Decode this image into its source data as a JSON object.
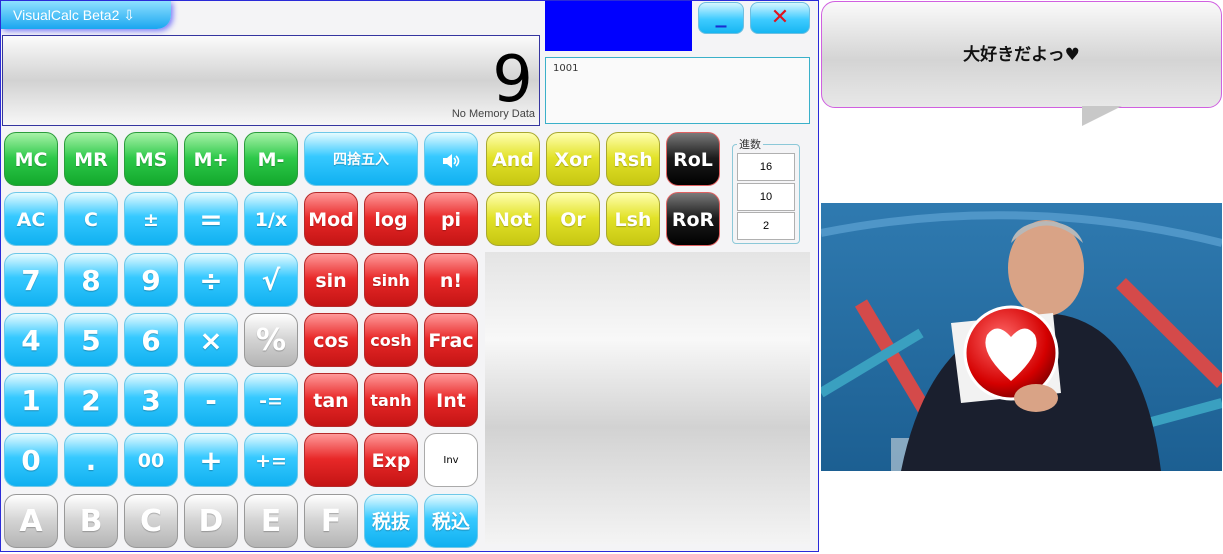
{
  "window": {
    "title": "VisualCalc Beta2",
    "title_icon": "⇩",
    "minimize_label": "_",
    "close_label": "✕"
  },
  "display": {
    "value": "9",
    "memory_status": "No Memory Data"
  },
  "history": {
    "text": "1001"
  },
  "buttons": {
    "mc": "MC",
    "mr": "MR",
    "ms": "MS",
    "mplus": "M+",
    "mminus": "M-",
    "round": "四捨五入",
    "sound_icon": "speaker-icon",
    "and": "And",
    "xor": "Xor",
    "rsh": "Rsh",
    "rol": "RoL",
    "ac": "AC",
    "c": "C",
    "plusminus": "±",
    "equals": "=",
    "reciprocal": "1/x",
    "mod": "Mod",
    "log": "log",
    "pi": "pi",
    "not": "Not",
    "or": "Or",
    "lsh": "Lsh",
    "ror": "RoR",
    "d7": "7",
    "d8": "8",
    "d9": "9",
    "divide": "÷",
    "sqrt": "√",
    "sin": "sin",
    "sinh": "sinh",
    "factorial": "n!",
    "d4": "4",
    "d5": "5",
    "d6": "6",
    "multiply": "×",
    "percent": "%",
    "cos": "cos",
    "cosh": "cosh",
    "frac": "Frac",
    "d1": "1",
    "d2": "2",
    "d3": "3",
    "minus": "-",
    "minus_eq": "-=",
    "tan": "tan",
    "tanh": "tanh",
    "int": "Int",
    "d0": "0",
    "dot": ".",
    "d00": "00",
    "plus": "+",
    "plus_eq": "+=",
    "blank_red": "",
    "exp": "Exp",
    "inv": "Inv",
    "hexA": "A",
    "hexB": "B",
    "hexC": "C",
    "hexD": "D",
    "hexE": "E",
    "hexF": "F",
    "tax_exclude": "税抜",
    "tax_include": "税込"
  },
  "base": {
    "label": "進数",
    "options": [
      "16",
      "10",
      "2"
    ]
  },
  "speech": {
    "text": "大好きだよっ♥"
  },
  "colors": {
    "accent_blue": "#0000ff",
    "green": "#2ec94a",
    "cyan": "#36c9ff",
    "red": "#e82828",
    "yellow": "#e2e228",
    "black": "#1c1c1c"
  }
}
